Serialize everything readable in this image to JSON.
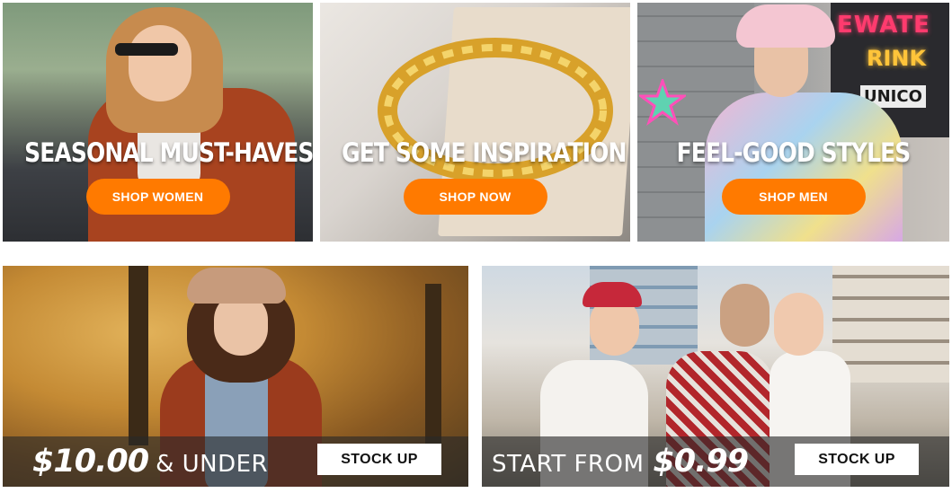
{
  "promos_top": [
    {
      "title": "SEASONAL MUST-HAVES",
      "button": "SHOP WOMEN"
    },
    {
      "title": "GET SOME INSPIRATION",
      "button": "SHOP NOW"
    },
    {
      "title": "FEEL-GOOD STYLES",
      "button": "SHOP MEN"
    }
  ],
  "promos_bottom": [
    {
      "price": "$10.00",
      "suffix": "& UNDER",
      "button": "STOCK UP"
    },
    {
      "prefix": "START FROM",
      "price": "$0.99",
      "button": "STOCK UP"
    }
  ],
  "sign_text": {
    "line1": "EWATE",
    "line2": "RINK",
    "line3": "UNICO"
  },
  "colors": {
    "accent": "#ff7a00",
    "overlay": "#282828",
    "button_light": "#ffffff"
  }
}
